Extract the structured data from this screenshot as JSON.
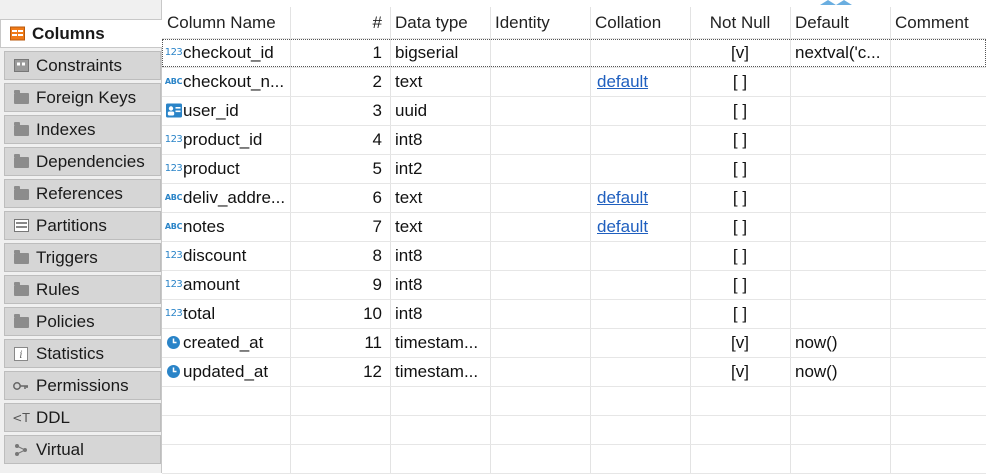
{
  "tabs": [
    {
      "label": "Columns",
      "icon": "columns-icon",
      "active": true
    },
    {
      "label": "Constraints",
      "icon": "constraints-icon"
    },
    {
      "label": "Foreign Keys",
      "icon": "folder-icon"
    },
    {
      "label": "Indexes",
      "icon": "folder-icon"
    },
    {
      "label": "Dependencies",
      "icon": "folder-icon"
    },
    {
      "label": "References",
      "icon": "folder-icon"
    },
    {
      "label": "Partitions",
      "icon": "partitions-icon"
    },
    {
      "label": "Triggers",
      "icon": "folder-icon"
    },
    {
      "label": "Rules",
      "icon": "folder-icon"
    },
    {
      "label": "Policies",
      "icon": "folder-icon"
    },
    {
      "label": "Statistics",
      "icon": "info-icon"
    },
    {
      "label": "Permissions",
      "icon": "key-icon"
    },
    {
      "label": "DDL",
      "icon": "ddl-icon"
    },
    {
      "label": "Virtual",
      "icon": "virtual-icon"
    }
  ],
  "columns_table": {
    "headers": [
      "Column Name",
      "#",
      "Data type",
      "Identity",
      "Collation",
      "Not Null",
      "Default",
      "Comment"
    ],
    "rows": [
      {
        "name": "checkout_id",
        "num": "1",
        "type": "bigserial",
        "identity": "",
        "collation": "",
        "not_null": "[v]",
        "default": "nextval('c...",
        "comment": "",
        "icon": "numeric-key-icon"
      },
      {
        "name": "checkout_n...",
        "num": "2",
        "type": "text",
        "identity": "",
        "collation": "default",
        "not_null": "[ ]",
        "default": "",
        "comment": "",
        "icon": "text-type-icon"
      },
      {
        "name": "user_id",
        "num": "3",
        "type": "uuid",
        "identity": "",
        "collation": "",
        "not_null": "[ ]",
        "default": "",
        "comment": "",
        "icon": "uuid-icon"
      },
      {
        "name": "product_id",
        "num": "4",
        "type": "int8",
        "identity": "",
        "collation": "",
        "not_null": "[ ]",
        "default": "",
        "comment": "",
        "icon": "numeric-type-icon"
      },
      {
        "name": "product",
        "num": "5",
        "type": "int2",
        "identity": "",
        "collation": "",
        "not_null": "[ ]",
        "default": "",
        "comment": "",
        "icon": "numeric-type-icon"
      },
      {
        "name": "deliv_addre...",
        "num": "6",
        "type": "text",
        "identity": "",
        "collation": "default",
        "not_null": "[ ]",
        "default": "",
        "comment": "",
        "icon": "text-type-icon"
      },
      {
        "name": "notes",
        "num": "7",
        "type": "text",
        "identity": "",
        "collation": "default",
        "not_null": "[ ]",
        "default": "",
        "comment": "",
        "icon": "text-type-icon"
      },
      {
        "name": "discount",
        "num": "8",
        "type": "int8",
        "identity": "",
        "collation": "",
        "not_null": "[ ]",
        "default": "",
        "comment": "",
        "icon": "numeric-type-icon"
      },
      {
        "name": "amount",
        "num": "9",
        "type": "int8",
        "identity": "",
        "collation": "",
        "not_null": "[ ]",
        "default": "",
        "comment": "",
        "icon": "numeric-type-icon"
      },
      {
        "name": "total",
        "num": "10",
        "type": "int8",
        "identity": "",
        "collation": "",
        "not_null": "[ ]",
        "default": "",
        "comment": "",
        "icon": "numeric-type-icon"
      },
      {
        "name": "created_at",
        "num": "11",
        "type": "timestam...",
        "identity": "",
        "collation": "",
        "not_null": "[v]",
        "default": "now()",
        "comment": "",
        "icon": "clock-icon"
      },
      {
        "name": "updated_at",
        "num": "12",
        "type": "timestam...",
        "identity": "",
        "collation": "",
        "not_null": "[v]",
        "default": "now()",
        "comment": "",
        "icon": "clock-icon"
      }
    ]
  },
  "colors": {
    "accent": "#2a84c8",
    "link": "#1f5fbf",
    "columns_icon": "#f07a18"
  }
}
